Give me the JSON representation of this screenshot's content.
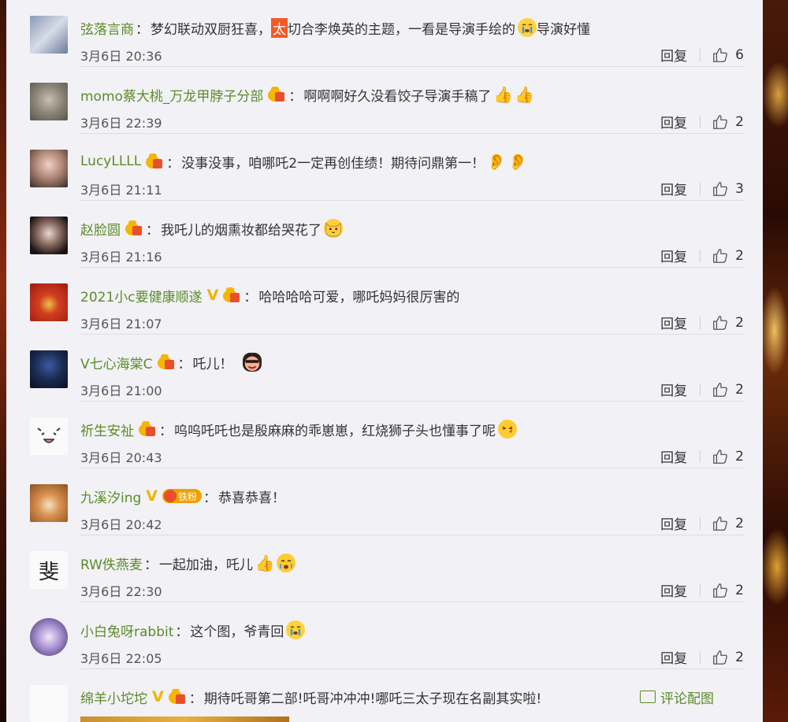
{
  "comments": [
    {
      "username": "弦落言商",
      "colon": "：",
      "text_parts": [
        "梦幻联动双厨狂喜，",
        "太",
        "切合李焕英的主题，一看是导演手绘的",
        "导演好懂"
      ],
      "date": "3月6日 20:36",
      "reply": "回复",
      "likes": "6"
    },
    {
      "username": "momo蔡大桃_万龙甲脖子分部",
      "colon": "：",
      "text": "啊啊啊好久没看饺子导演手稿了",
      "date": "3月6日 22:39",
      "reply": "回复",
      "likes": "2"
    },
    {
      "username": "LucyLLLL",
      "colon": "：",
      "text": "没事没事，咱哪吒2一定再创佳绩！期待问鼎第一！",
      "date": "3月6日 21:11",
      "reply": "回复",
      "likes": "3"
    },
    {
      "username": "赵脸圆",
      "colon": "：",
      "text": "我吒儿的烟熏妆都给哭花了",
      "date": "3月6日 21:16",
      "reply": "回复",
      "likes": "2"
    },
    {
      "username": "2021小c要健康顺遂",
      "colon": "：",
      "text": "哈哈哈哈可爱，哪吒妈妈很厉害的",
      "date": "3月6日 21:07",
      "reply": "回复",
      "likes": "2"
    },
    {
      "username": "V七心海棠C",
      "colon": "：",
      "text": "吒儿！",
      "date": "3月6日 21:00",
      "reply": "回复",
      "likes": "2"
    },
    {
      "username": "祈生安祉",
      "colon": "：",
      "text": "呜呜吒吒也是殷麻麻的乖崽崽，红烧狮子头也懂事了呢",
      "date": "3月6日 20:43",
      "reply": "回复",
      "likes": "2"
    },
    {
      "username": "九溪汐ing",
      "colon": "：",
      "badge": "铁粉",
      "text": "恭喜恭喜！",
      "date": "3月6日 20:42",
      "reply": "回复",
      "likes": "2"
    },
    {
      "username": "RW佚燕麦",
      "colon": "：",
      "text": "一起加油，吒儿",
      "date": "3月6日 22:30",
      "reply": "回复",
      "likes": "2"
    },
    {
      "username": "小白兔呀rabbit",
      "colon": "：",
      "text": "这个图，爷青回",
      "date": "3月6日 22:05",
      "reply": "回复",
      "likes": "2"
    },
    {
      "username": "绵羊小坨坨",
      "colon": "：",
      "text": "期待吒哥第二部!吒哥冲冲冲!哪吒三太子现在名副其实啦!",
      "pic_link": "评论配图"
    }
  ],
  "avatars": {
    "a9_glyph": "斐"
  },
  "colors": {
    "username": "#5b8c2a",
    "panel_bg": "#f2f1f5",
    "highlight": "#f05a2a",
    "vip_gold": "#f0b400"
  }
}
